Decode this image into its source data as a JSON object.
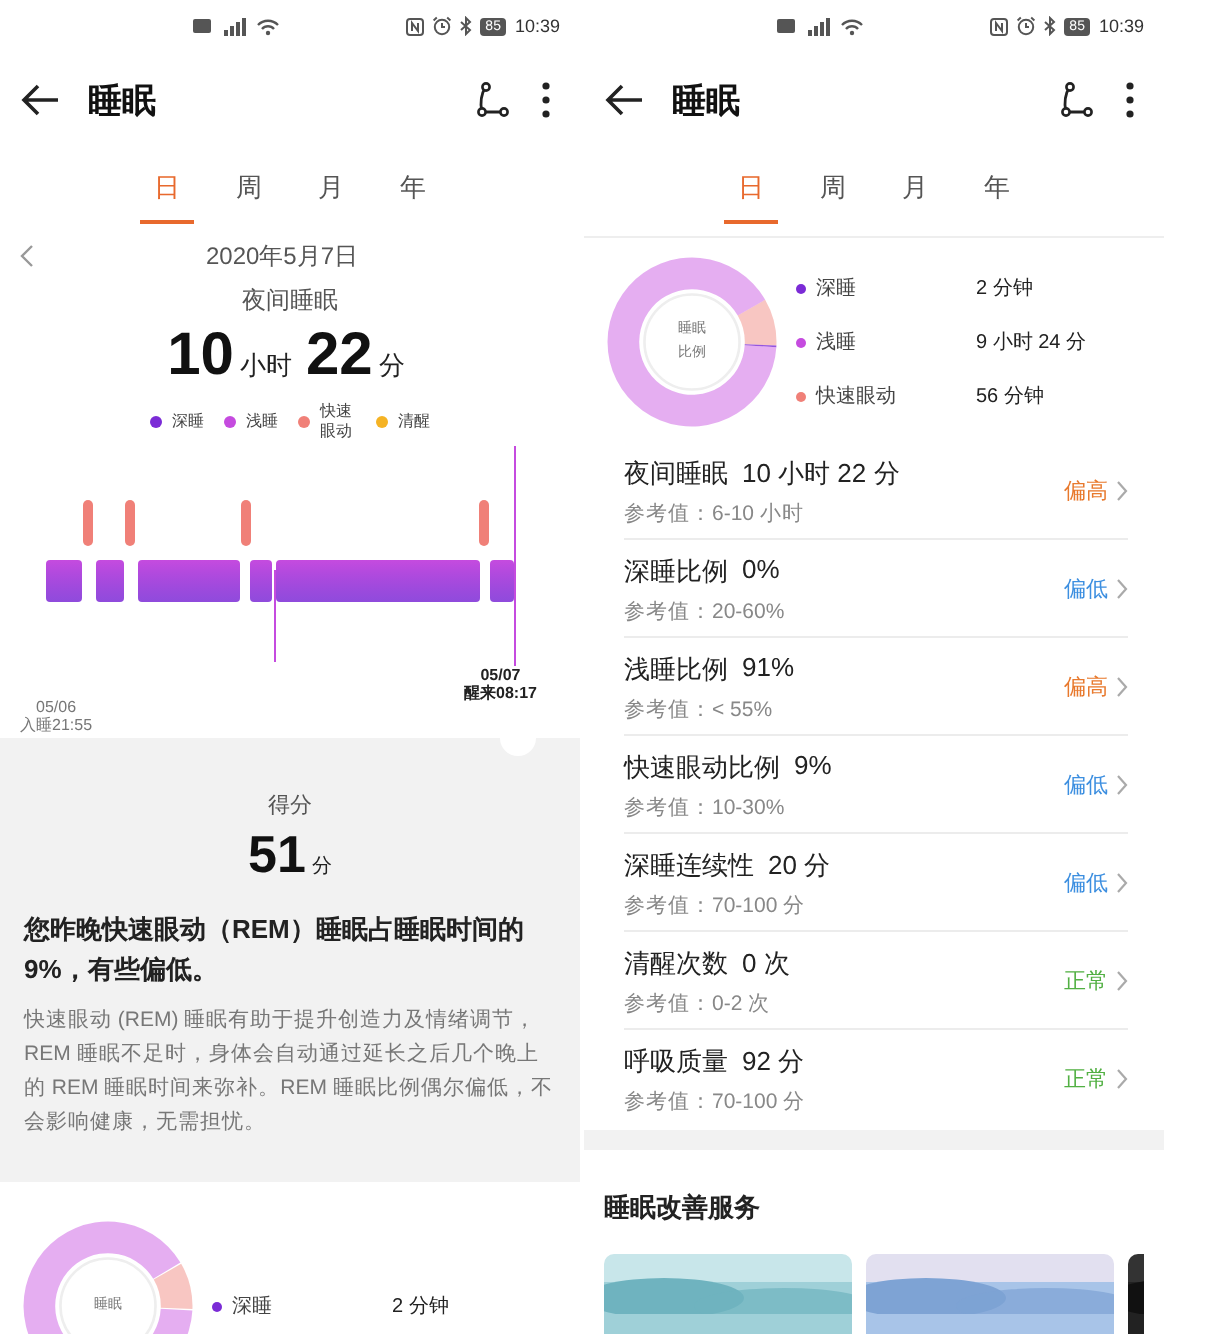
{
  "screens": [
    {
      "status_bar": {
        "battery": "85",
        "time": "10:39"
      },
      "header": {
        "title": "睡眠"
      },
      "tabs": [
        {
          "label": "日",
          "selected": true
        },
        {
          "label": "周",
          "selected": false
        },
        {
          "label": "月",
          "selected": false
        },
        {
          "label": "年",
          "selected": false
        }
      ],
      "sections": [
        {
          "kind": "overview",
          "date": "2020年5月7日",
          "sleep_type": "夜间睡眠",
          "hours": "10",
          "hours_unit": "小时",
          "minutes": "22",
          "minutes_unit": "分",
          "legend": [
            {
              "label": "深睡",
              "color": "#7b2bd6"
            },
            {
              "label": "浅睡",
              "color": "#c54bdf"
            },
            {
              "label": "快速眼动",
              "color": "#f08078"
            },
            {
              "label": "清醒",
              "color": "#f5b324"
            }
          ],
          "start_date": "05/06",
          "start_time": "入睡21:55",
          "end_date": "05/07",
          "end_time": "醒来08:17"
        },
        {
          "kind": "score",
          "label": "得分",
          "value": "51",
          "unit": "分",
          "summary": "您昨晚快速眼动（REM）睡眠占睡眠时间的9%，有些偏低。",
          "description": "快速眼动 (REM) 睡眠有助于提升创造力及情绪调节，REM 睡眠不足时，身体会自动通过延长之后几个晚上的 REM 睡眠时间来弥补。REM 睡眠比例偶尔偏低，不会影响健康，无需担忧。"
        },
        {
          "kind": "ratio",
          "center_label": [
            "睡眠"
          ],
          "items": [
            {
              "label": "深睡",
              "value": "2 分钟",
              "color": "#7b2bd6"
            }
          ]
        }
      ]
    },
    {
      "status_bar": {
        "battery": "85",
        "time": "10:39"
      },
      "header": {
        "title": "睡眠"
      },
      "tabs": [
        {
          "label": "日",
          "selected": true
        },
        {
          "label": "周",
          "selected": false
        },
        {
          "label": "月",
          "selected": false
        },
        {
          "label": "年",
          "selected": false
        }
      ],
      "sections": [
        {
          "kind": "ratio",
          "center_label": [
            "睡眠",
            "比例"
          ],
          "items": [
            {
              "value": "2 分钟",
              "color": "#7b2bd6"
            },
            {
              "value": "9 小时 24 分",
              "color": "#c54bdf"
            },
            {
              "value": "56 分钟",
              "color": "#f08078"
            }
          ],
          "chart_data": {
            "type": "donut",
            "categories": [
              "深睡",
              "浅睡",
              "快速眼动"
            ],
            "values": [
              0.3,
              90.7,
              9.0
            ]
          }
        },
        {
          "kind": "metrics",
          "rows": [
            {
              "name": "夜间睡眠",
              "value": "10 小时 22 分",
              "reference": "参考值：6-10 小时",
              "status": "偏高",
              "kind": "high"
            },
            {
              "name": "深睡比例",
              "value": "0%",
              "reference": "参考值：20-60%",
              "status": "偏低",
              "kind": "low"
            },
            {
              "name": "浅睡比例",
              "value": "91%",
              "reference": "参考值：< 55%",
              "status": "偏高",
              "kind": "high"
            },
            {
              "name": "快速眼动比例",
              "value": "9%",
              "reference": "参考值：10-30%",
              "status": "偏低",
              "kind": "low"
            },
            {
              "name": "深睡连续性",
              "value": "20 分",
              "reference": "参考值：70-100 分",
              "status": "偏低",
              "kind": "low"
            },
            {
              "name": "清醒次数",
              "value": "0 次",
              "reference": "参考值：0-2 次",
              "status": "正常",
              "kind": "normal"
            },
            {
              "name": "呼吸质量",
              "value": "92 分",
              "reference": "参考值：70-100 分",
              "status": "正常",
              "kind": "normal"
            }
          ]
        },
        {
          "kind": "services",
          "title": "睡眠改善服务"
        }
      ]
    }
  ]
}
